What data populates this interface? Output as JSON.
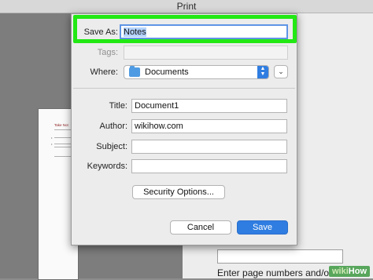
{
  "window": {
    "title": "Print"
  },
  "dialog": {
    "save_as": {
      "label": "Save As:",
      "value": "Notes"
    },
    "tags": {
      "label": "Tags:"
    },
    "where": {
      "label": "Where:",
      "value": "Documents",
      "icon": "folder-icon"
    },
    "title": {
      "label": "Title:",
      "value": "Document1"
    },
    "author": {
      "label": "Author:",
      "value": "wikihow.com"
    },
    "subject": {
      "label": "Subject:",
      "value": ""
    },
    "keywords": {
      "label": "Keywords:",
      "value": ""
    },
    "security_button": "Security Options...",
    "cancel_button": "Cancel",
    "save_button": "Save",
    "highlight_color": "#22e814",
    "accent_color": "#2f7de1"
  },
  "background": {
    "doc_heading": "Take Not",
    "page_numbers_label": "Enter page numbers and/or"
  },
  "watermark": {
    "brand_wiki": "wiki",
    "brand_how": "How"
  }
}
